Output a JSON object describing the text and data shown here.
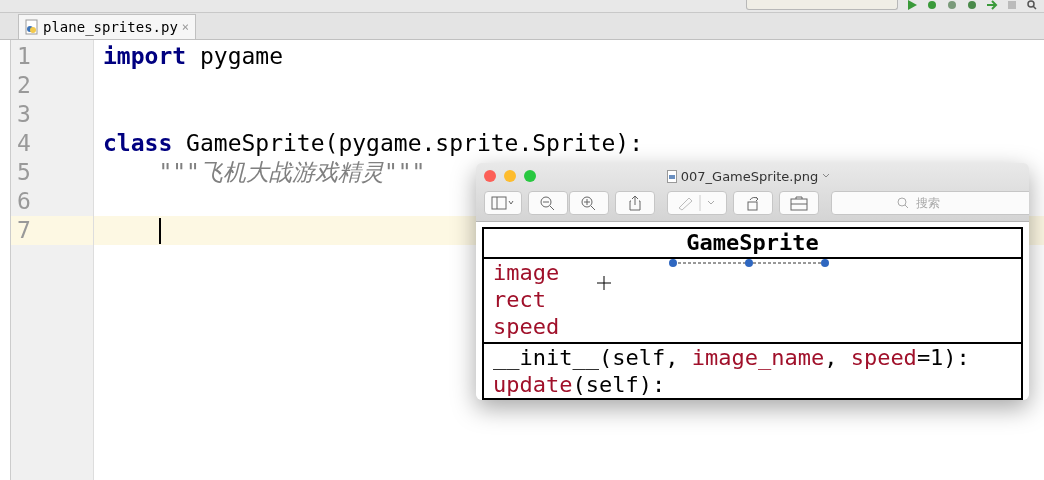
{
  "editor_tabs": [
    {
      "label": "plane_sprites.py",
      "close": "×",
      "selected": true
    }
  ],
  "code_lines": [
    {
      "number": "1",
      "current": false,
      "segments": [
        {
          "kind": "keyword",
          "text": "import"
        },
        {
          "kind": "plain",
          "text": " pygame"
        }
      ]
    },
    {
      "number": "2",
      "current": false
    },
    {
      "number": "3",
      "current": false
    },
    {
      "number": "4",
      "current": false,
      "segments": [
        {
          "kind": "keyword",
          "text": "class"
        },
        {
          "kind": "plain",
          "text": " GameSprite(pygame.sprite.Sprite):"
        }
      ]
    },
    {
      "number": "5",
      "current": false,
      "segments": [
        {
          "kind": "docstring",
          "text": "    \"\"\"飞机大战游戏精灵\"\"\""
        }
      ]
    },
    {
      "number": "6",
      "current": false
    },
    {
      "number": "7",
      "current": true
    }
  ],
  "preview_window": {
    "title": "007_GameSprite.png",
    "search": {
      "placeholder": "搜索"
    },
    "uml": {
      "class_name": "GameSprite",
      "attributes": [
        "image",
        "rect",
        "speed"
      ],
      "methods": [
        [
          {
            "kind": "plain",
            "text": "__init__(self, "
          },
          {
            "kind": "name",
            "text": "image_name"
          },
          {
            "kind": "plain",
            "text": ", "
          },
          {
            "kind": "name",
            "text": "speed"
          },
          {
            "kind": "plain",
            "text": "=1):"
          }
        ],
        [
          {
            "kind": "name",
            "text": "update"
          },
          {
            "kind": "plain",
            "text": "(self):"
          }
        ]
      ]
    }
  }
}
